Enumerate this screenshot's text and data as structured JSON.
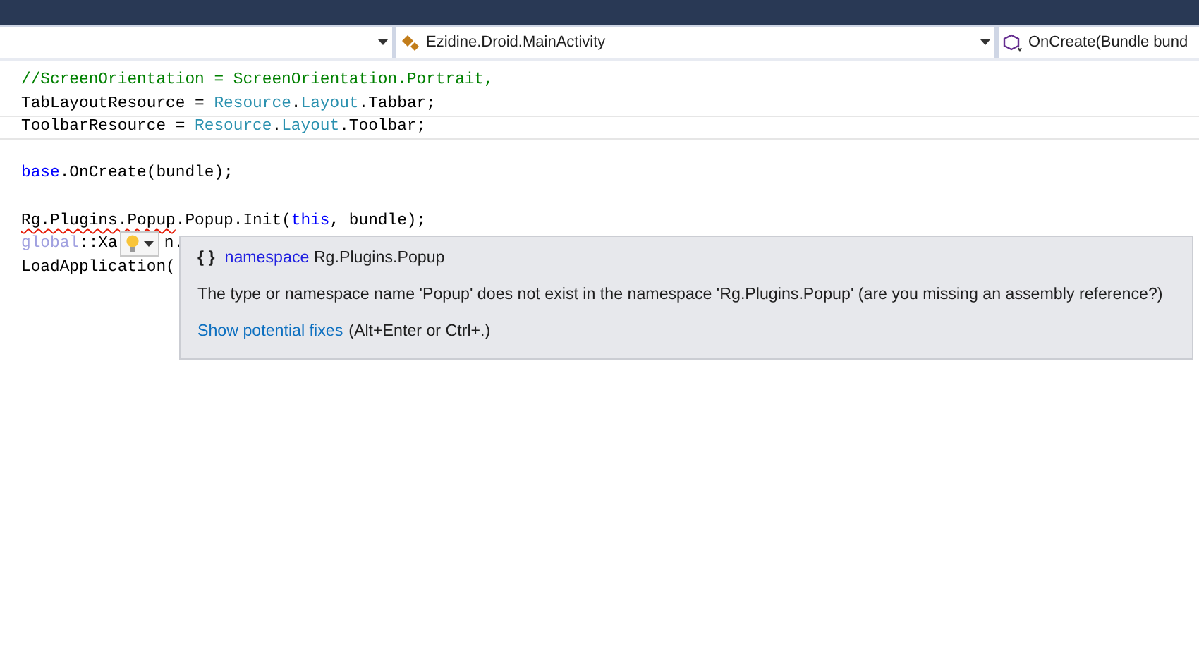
{
  "nav_bar": {
    "dropdowns": [
      {
        "kind": "blank"
      },
      {
        "kind": "class",
        "text": "Ezidine.Droid.MainActivity"
      },
      {
        "kind": "method",
        "text": "OnCreate(Bundle bund"
      }
    ]
  },
  "editor": {
    "lines": [
      {
        "kind": "code",
        "current": false,
        "tokens": [
          {
            "kind": "comment",
            "text": "//ScreenOrientation = ScreenOrientation.Portrait,"
          }
        ]
      },
      {
        "kind": "code",
        "current": false,
        "tokens": [
          {
            "kind": "plain",
            "text": "TabLayoutResource = "
          },
          {
            "kind": "type",
            "text": "Resource"
          },
          {
            "kind": "plain",
            "text": "."
          },
          {
            "kind": "type",
            "text": "Layout"
          },
          {
            "kind": "plain",
            "text": ".Tabbar;"
          }
        ]
      },
      {
        "kind": "code",
        "current": true,
        "tokens": [
          {
            "kind": "plain",
            "text": "ToolbarResource = "
          },
          {
            "kind": "type",
            "text": "Resource"
          },
          {
            "kind": "plain",
            "text": "."
          },
          {
            "kind": "type",
            "text": "Layout"
          },
          {
            "kind": "plain",
            "text": ".Toolbar;"
          }
        ]
      },
      {
        "kind": "blank"
      },
      {
        "kind": "code",
        "current": false,
        "tokens": [
          {
            "kind": "keyword",
            "text": "base"
          },
          {
            "kind": "plain",
            "text": ".OnCreate(bundle);"
          }
        ]
      },
      {
        "kind": "blank"
      },
      {
        "kind": "code",
        "current": false,
        "tokens": [
          {
            "kind": "error",
            "text": "Rg.Plugins.Popup"
          },
          {
            "kind": "plain",
            "text": ".Popup.Init("
          },
          {
            "kind": "keyword",
            "text": "this"
          },
          {
            "kind": "plain",
            "text": ", bundle);"
          }
        ]
      },
      {
        "kind": "code",
        "current": false,
        "tokens": [
          {
            "kind": "dim",
            "text": "global"
          },
          {
            "kind": "plain",
            "text": "::Xa"
          },
          {
            "kind": "lightbulb"
          },
          {
            "kind": "plain",
            "text": "n."
          }
        ]
      },
      {
        "kind": "code",
        "current": false,
        "tokens": [
          {
            "kind": "plain",
            "text": "LoadApplication("
          }
        ]
      }
    ]
  },
  "tooltip": {
    "icon": "{ }",
    "keyword": "namespace",
    "name": "Rg.Plugins.Popup",
    "message": "The type or namespace name 'Popup' does not exist in the namespace 'Rg.Plugins.Popup' (are you missing an assembly reference?)",
    "link": "Show potential fixes",
    "shortcut": "(Alt+Enter or Ctrl+.)"
  }
}
